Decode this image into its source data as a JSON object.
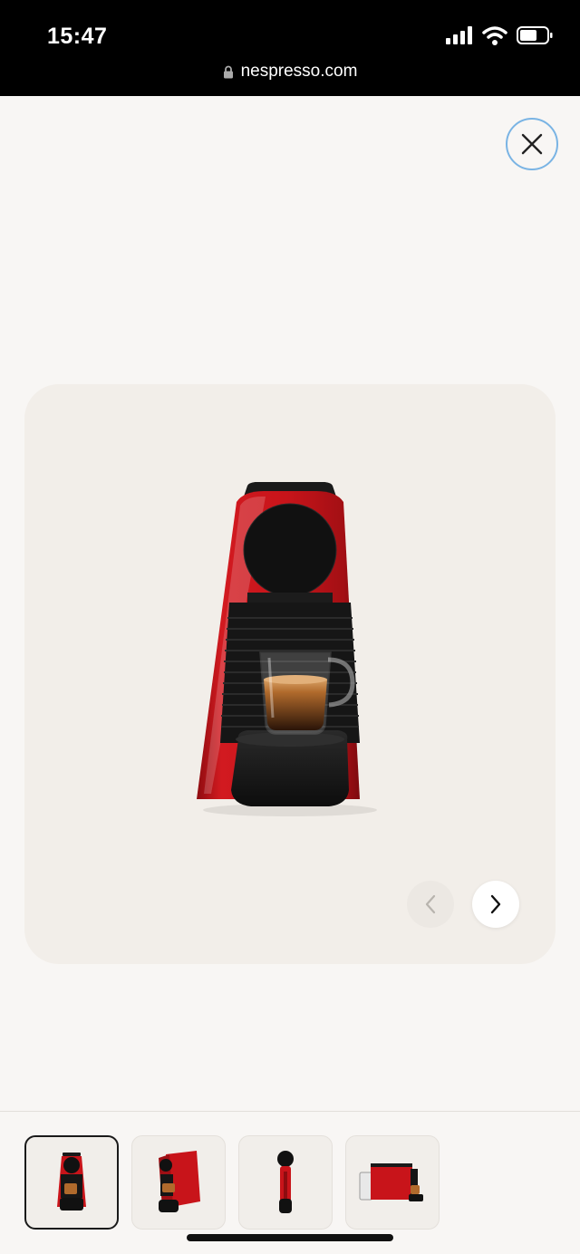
{
  "status_bar": {
    "time": "15:47",
    "url": "nespresso.com",
    "icons": [
      "signal-icon",
      "wifi-icon",
      "battery-icon"
    ]
  },
  "close_button": {
    "icon": "close-icon"
  },
  "gallery": {
    "product_image": "espresso-machine-red-front",
    "prev_icon": "chevron-left-icon",
    "next_icon": "chevron-right-icon",
    "prev_enabled": false
  },
  "thumbnails": [
    {
      "view": "front",
      "active": true
    },
    {
      "view": "three-quarter",
      "active": false
    },
    {
      "view": "side",
      "active": false
    },
    {
      "view": "with-milk-frother",
      "active": false
    }
  ],
  "colors": {
    "machine_red": "#c8141a",
    "close_ring": "#7ab4e4",
    "gallery_bg": "#f2eee9",
    "page_bg": "#f8f6f4"
  }
}
